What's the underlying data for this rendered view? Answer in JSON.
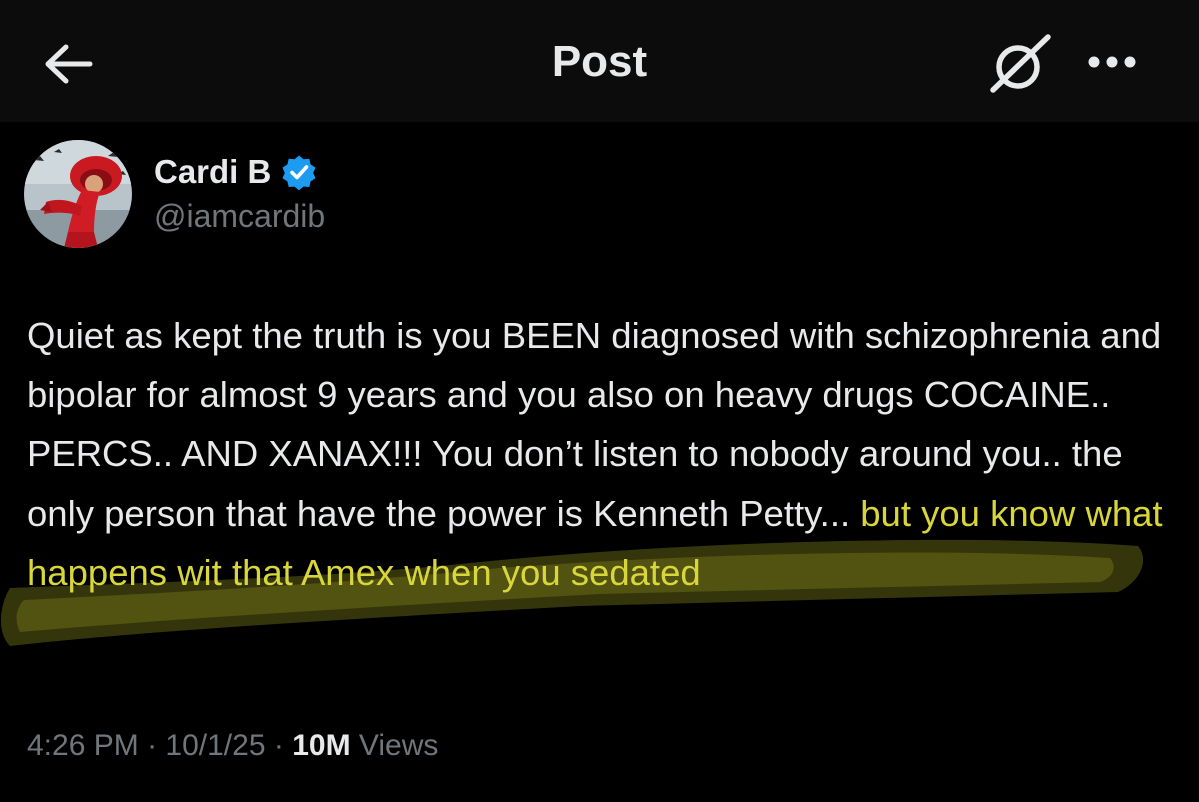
{
  "header": {
    "title": "Post",
    "back_icon": "arrow-left-icon",
    "grok_icon": "grok-icon",
    "more_icon": "more-horizontal-icon"
  },
  "author": {
    "display_name": "Cardi B",
    "handle": "@iamcardib",
    "verified": true,
    "verified_color": "#1d9bf0"
  },
  "post": {
    "text_plain": "Quiet as kept the truth is you BEEN diagnosed with schizophrenia and bipolar for almost 9 years and you also on heavy drugs COCAINE.. PERCS.. AND XANAX!!! You don’t listen to nobody around you.. the only person that have the power is Kenneth Petty...",
    "text_highlighted": " but you know what happens wit that Amex when you sedated",
    "highlight_color": "#d9d63a"
  },
  "meta": {
    "time": "4:26 PM",
    "date": "10/1/25",
    "separator": "·",
    "views_count": "10M",
    "views_label": "Views"
  },
  "colors": {
    "background": "#000000",
    "header_background": "#0c0c0c",
    "text_primary": "#e7e9ea",
    "text_secondary": "#71767b"
  }
}
